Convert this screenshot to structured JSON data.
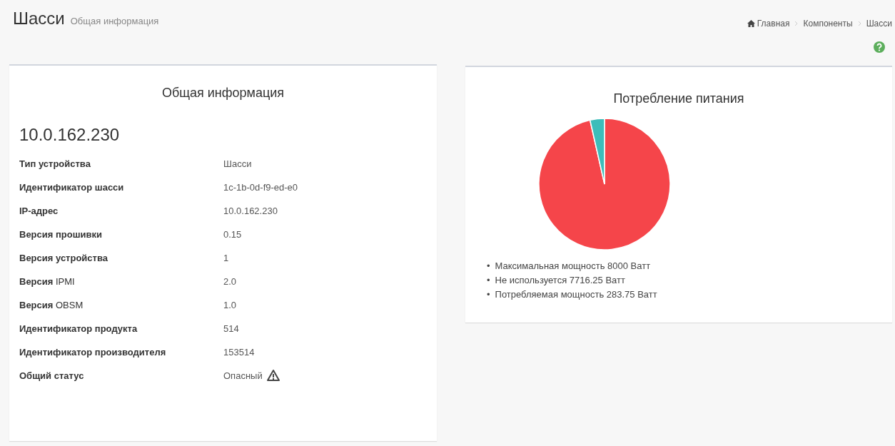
{
  "header": {
    "title": "Шасси",
    "subtitle": "Общая информация"
  },
  "breadcrumb": [
    "Главная",
    "Компоненты",
    "Шасси"
  ],
  "info_panel": {
    "title": "Общая информация",
    "host": "10.0.162.230",
    "rows": [
      {
        "label": "Тип устройства",
        "value": "Шасси"
      },
      {
        "label": "Идентификатор шасси",
        "value": "1c-1b-0d-f9-ed-e0"
      },
      {
        "label": "IP-адрес",
        "value": "10.0.162.230"
      },
      {
        "label": "Версия прошивки",
        "value": "0.15"
      },
      {
        "label": "Версия устройства",
        "value": "1"
      },
      {
        "label": "**Версия** IPMI",
        "value": "2.0"
      },
      {
        "label": "**Версия** OBSM",
        "value": "1.0"
      },
      {
        "label": "Идентификатор продукта",
        "value": "514"
      },
      {
        "label": "Идентификатор производителя",
        "value": "153514"
      },
      {
        "label": "Общий статус",
        "value": "Опасный",
        "warning": true
      }
    ]
  },
  "power_panel": {
    "title": "Потребление питания",
    "chart_data": {
      "type": "pie",
      "values": [
        96.45,
        3.55
      ],
      "colors": [
        "#f5454a",
        "#3dbdba"
      ]
    },
    "legend": [
      {
        "marker": "•",
        "text": "Максимальная мощность 8000 Ватт"
      },
      {
        "marker": "•",
        "text": "Не используется 7716.25 Ватт"
      },
      {
        "marker": "•",
        "text": "Потребляемая мощность 283.75 Ватт"
      }
    ]
  }
}
